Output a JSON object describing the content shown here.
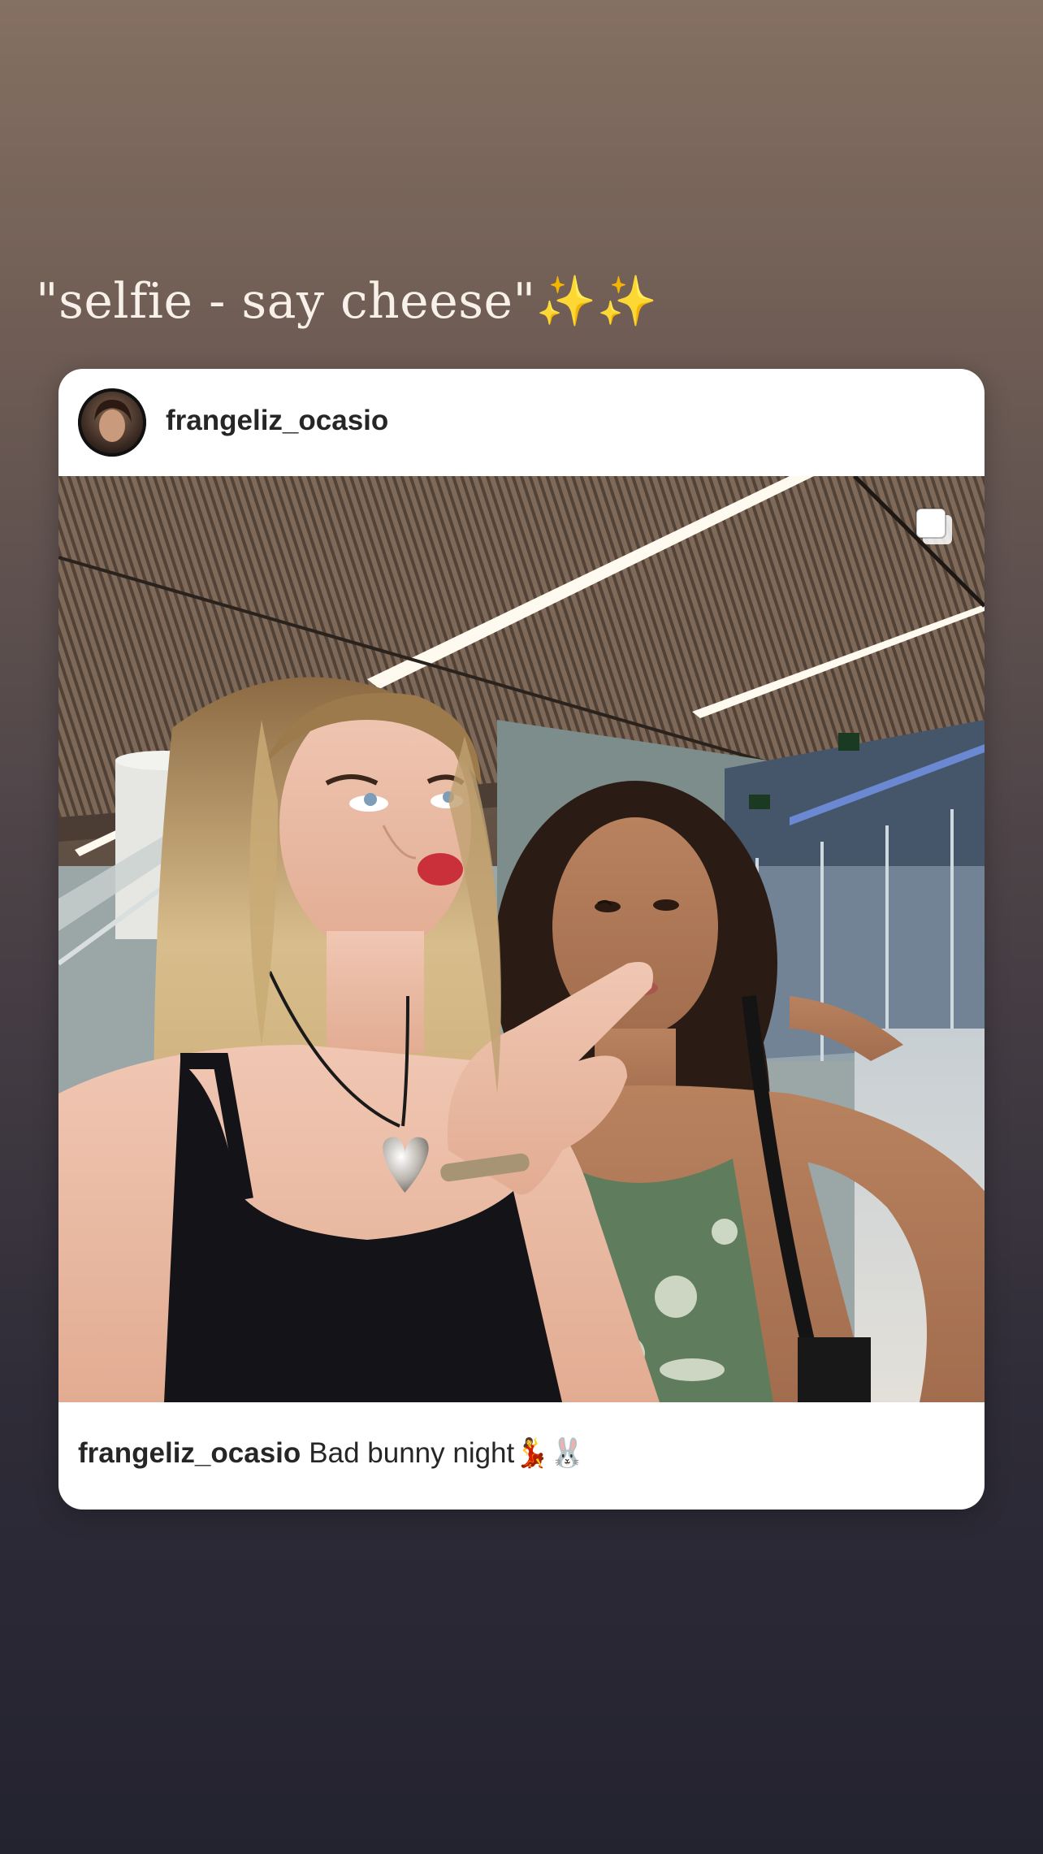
{
  "story": {
    "caption": "\"selfie - say cheese\"✨✨"
  },
  "post": {
    "username": "frangeliz_ocasio",
    "photo_alt": "",
    "caption": {
      "username": "frangeliz_ocasio",
      "text": "Bad bunny night💃🐰"
    },
    "icons": {
      "multi": "carousel-icon",
      "avatar": "profile-avatar"
    }
  }
}
